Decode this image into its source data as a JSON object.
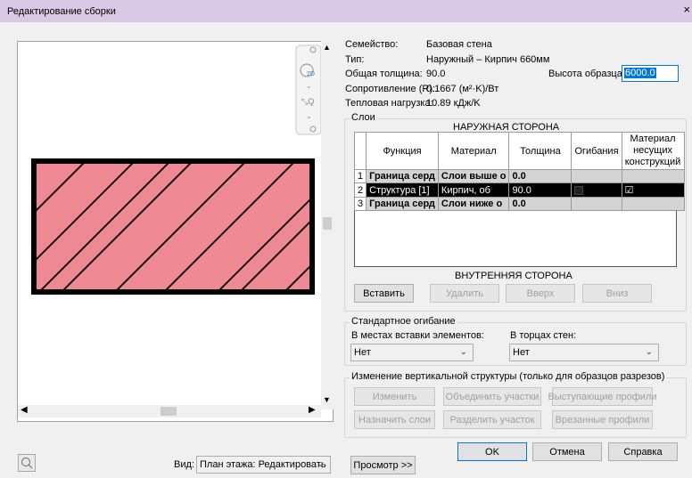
{
  "window": {
    "title": "Редактирование сборки",
    "close": "×"
  },
  "info": {
    "family_label": "Семейство:",
    "family_value": "Базовая стена",
    "type_label": "Тип:",
    "type_value": "Наружный – Кирпич 660мм",
    "thickness_label": "Общая толщина:",
    "thickness_value": "90.0",
    "resistance_label": "Сопротивление (R):",
    "resistance_value": "0.1667 (м²·K)/Вт",
    "thermal_label": "Тепловая нагрузка:",
    "thermal_value": "10.89 кДж/K",
    "sample_height_label": "Высота образца:",
    "sample_height_value": "6000.0"
  },
  "layers": {
    "group_label": "Слои",
    "exterior_side": "НАРУЖНАЯ СТОРОНА",
    "interior_side": "ВНУТРЕННЯЯ СТОРОНА",
    "headers": [
      "Функция",
      "Материал",
      "Толщина",
      "Огибания",
      "Материал несущих конструкций"
    ],
    "rows": [
      {
        "num": "1",
        "function": "Граница серд",
        "material": "Слои выше о",
        "thickness": "0.0",
        "wrap": "",
        "structural": ""
      },
      {
        "num": "2",
        "function": "Структура [1]",
        "material": "Кирпич, об",
        "thickness": "90.0",
        "wrap": "",
        "structural": "☑"
      },
      {
        "num": "3",
        "function": "Граница серд",
        "material": "Слои ниже о",
        "thickness": "0.0",
        "wrap": "",
        "structural": ""
      }
    ],
    "buttons": {
      "insert": "Вставить",
      "delete": "Удалить",
      "up": "Вверх",
      "down": "Вниз"
    }
  },
  "wrapping": {
    "group_label": "Стандартное огибание",
    "inserts_label": "В местах вставки элементов:",
    "inserts_value": "Нет",
    "ends_label": "В торцах стен:",
    "ends_value": "Нет"
  },
  "vertical": {
    "group_label": "Изменение вертикальной структуры (только для образцов разрезов)",
    "buttons": {
      "modify": "Изменить",
      "merge": "Объединить участки",
      "sweeps": "Выступающие профили",
      "assign": "Назначить слои",
      "split": "Разделить участок",
      "reveals": "Врезанные профили"
    }
  },
  "footer": {
    "view_label": "Вид:",
    "view_value": "План этажа: Редактировать",
    "preview_button": "Просмотр >>",
    "ok": "OK",
    "cancel": "Отмена",
    "help": "Справка"
  },
  "colors": {
    "title_bar": "#d9c8e6",
    "wall_fill": "#ef8a94",
    "selected_row": "#000000"
  }
}
